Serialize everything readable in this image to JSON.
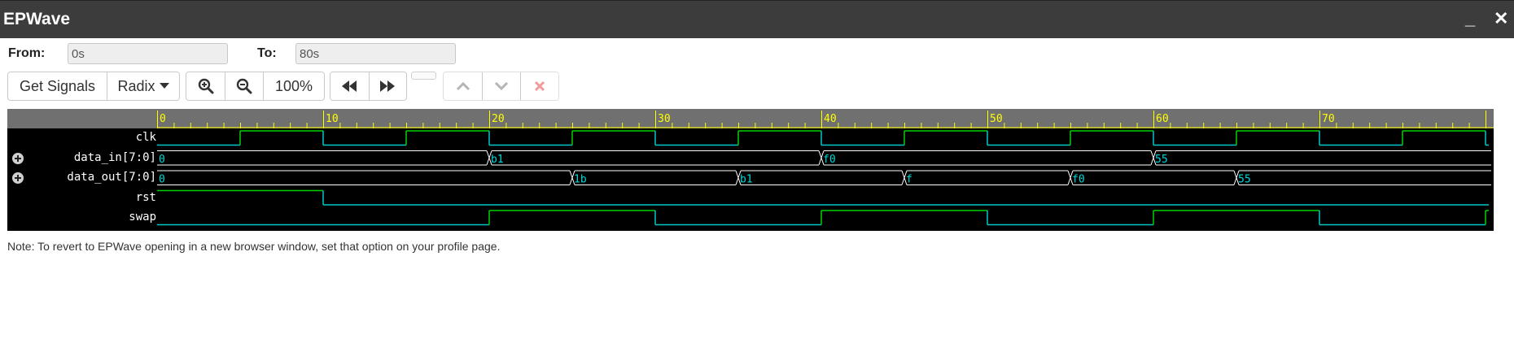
{
  "window": {
    "title": "EPWave",
    "minimize_label": "_",
    "close_label": "✕"
  },
  "range": {
    "from_label": "From:",
    "from_value": "0s",
    "to_label": "To:",
    "to_value": "80s"
  },
  "toolbar": {
    "get_signals_label": "Get Signals",
    "radix_label": "Radix",
    "zoom_level": "100%",
    "icons": [
      "zoom-in-icon",
      "zoom-out-icon",
      "rewind-icon",
      "fast-forward-icon",
      "chevron-up-icon",
      "chevron-down-icon",
      "close-icon"
    ]
  },
  "waveform": {
    "time_range": [
      0,
      80
    ],
    "ruler_labels": [
      "0",
      "10",
      "20",
      "30",
      "40",
      "50",
      "60",
      "70"
    ],
    "signals": [
      {
        "name": "clk",
        "type": "bit",
        "expandable": false,
        "initial": 0,
        "transitions": [
          [
            5,
            1
          ],
          [
            10,
            0
          ],
          [
            15,
            1
          ],
          [
            20,
            0
          ],
          [
            25,
            1
          ],
          [
            30,
            0
          ],
          [
            35,
            1
          ],
          [
            40,
            0
          ],
          [
            45,
            1
          ],
          [
            50,
            0
          ],
          [
            55,
            1
          ],
          [
            60,
            0
          ],
          [
            65,
            1
          ],
          [
            70,
            0
          ],
          [
            75,
            1
          ],
          [
            80,
            0
          ]
        ]
      },
      {
        "name": "data_in[7:0]",
        "type": "bus",
        "expandable": true,
        "segments": [
          [
            0,
            "0"
          ],
          [
            20,
            "b1"
          ],
          [
            40,
            "f0"
          ],
          [
            60,
            "55"
          ]
        ]
      },
      {
        "name": "data_out[7:0]",
        "type": "bus",
        "expandable": true,
        "segments": [
          [
            0,
            "0"
          ],
          [
            25,
            "1b"
          ],
          [
            35,
            "b1"
          ],
          [
            45,
            "f"
          ],
          [
            55,
            "f0"
          ],
          [
            65,
            "55"
          ]
        ]
      },
      {
        "name": "rst",
        "type": "bit",
        "expandable": false,
        "initial": 1,
        "transitions": [
          [
            10,
            0
          ]
        ]
      },
      {
        "name": "swap",
        "type": "bit",
        "expandable": false,
        "initial": 0,
        "transitions": [
          [
            20,
            1
          ],
          [
            30,
            0
          ],
          [
            40,
            1
          ],
          [
            50,
            0
          ],
          [
            60,
            1
          ],
          [
            70,
            0
          ],
          [
            80,
            1
          ]
        ]
      }
    ],
    "colors": {
      "background": "#000000",
      "ruler": "#707070",
      "tick": "#ffff00",
      "high": "#00d000",
      "low": "#00c8c8",
      "bus": "#ffffff",
      "bus_text": "#00d8d8",
      "label": "#ffffff"
    }
  },
  "note": "Note: To revert to EPWave opening in a new browser window, set that option on your profile page."
}
